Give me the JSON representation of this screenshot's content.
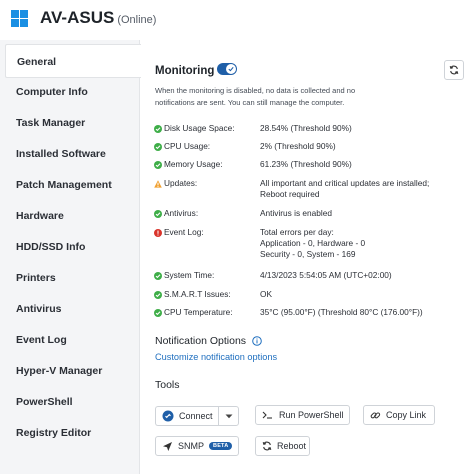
{
  "header": {
    "title": "AV-ASUS",
    "status": "(Online)"
  },
  "sidebar": {
    "items": [
      {
        "label": "General",
        "active": true
      },
      {
        "label": "Computer Info"
      },
      {
        "label": "Task Manager"
      },
      {
        "label": "Installed Software"
      },
      {
        "label": "Patch Management"
      },
      {
        "label": "Hardware"
      },
      {
        "label": "HDD/SSD Info"
      },
      {
        "label": "Printers"
      },
      {
        "label": "Antivirus"
      },
      {
        "label": "Event Log"
      },
      {
        "label": "Hyper-V Manager"
      },
      {
        "label": "PowerShell"
      },
      {
        "label": "Registry Editor"
      }
    ]
  },
  "monitoring": {
    "title": "Monitoring",
    "enabled": true,
    "description_line1": "When the monitoring is disabled, no data is collected and no",
    "description_line2": "notifications are sent. You can still manage the computer."
  },
  "status_rows": [
    {
      "icon": "check-circle-icon",
      "label": "Disk Usage Space:",
      "value": [
        "28.54% (Threshold 90%)"
      ]
    },
    {
      "icon": "check-circle-icon",
      "label": "CPU Usage:",
      "value": [
        "2% (Threshold 90%)"
      ]
    },
    {
      "icon": "check-circle-icon",
      "label": "Memory Usage:",
      "value": [
        "61.23% (Threshold 90%)"
      ]
    },
    {
      "icon": "warning-icon",
      "label": "Updates:",
      "value": [
        "All important and critical updates are installed;",
        "Reboot required"
      ]
    },
    {
      "icon": "check-circle-icon",
      "label": "Antivirus:",
      "value": [
        "Antivirus is enabled"
      ]
    },
    {
      "icon": "error-icon",
      "label": "Event Log:",
      "value": [
        "Total errors per day:",
        "Application - 0, Hardware - 0",
        "Security - 0, System - 169"
      ]
    },
    {
      "icon": "check-circle-icon",
      "label": "System Time:",
      "value": [
        "4/13/2023 5:54:05 AM (UTC+02:00)"
      ]
    },
    {
      "icon": "check-circle-icon",
      "label": "S.M.A.R.T Issues:",
      "value": [
        "OK"
      ]
    },
    {
      "icon": "check-circle-icon",
      "label": "CPU Temperature:",
      "value": [
        "35°C (95.00°F) (Threshold 80°C (176.00°F))"
      ]
    }
  ],
  "notification": {
    "title": "Notification Options",
    "link": "Customize notification options"
  },
  "tools": {
    "title": "Tools",
    "connect": "Connect",
    "run_powershell": "Run PowerShell",
    "copy_link": "Copy Link",
    "snmp": "SNMP",
    "snmp_badge": "BETA",
    "reboot": "Reboot"
  },
  "colors": {
    "accent": "#1f5fa8",
    "ok": "#3fae49",
    "warning": "#f0a030",
    "error": "#d9342b",
    "link": "#1f6fbf",
    "windows": "#1a8fe3"
  }
}
